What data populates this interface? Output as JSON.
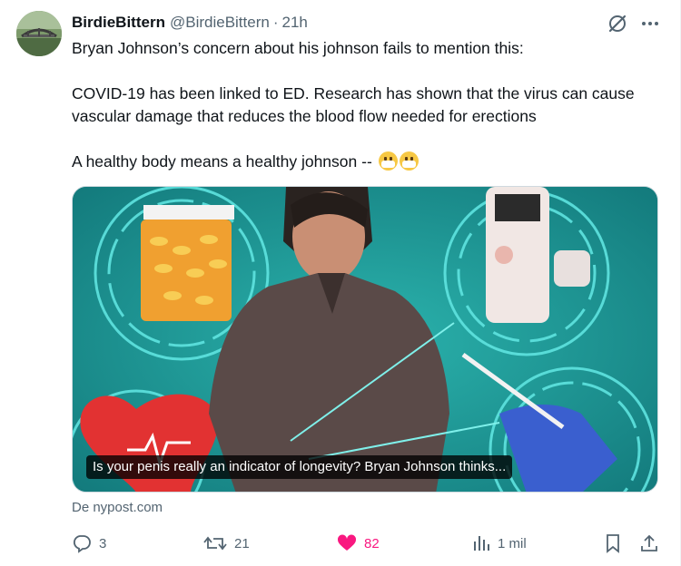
{
  "post": {
    "display_name": "BirdieBittern",
    "handle": "@BirdieBittern",
    "separator": "·",
    "time": "21h",
    "text_lines": [
      "Bryan Johnson’s concern about his johnson fails to mention this:",
      "COVID-19 has been linked to ED. Research has shown that the virus can cause",
      "vascular damage that reduces the blood flow needed for erections",
      "A healthy body means a healthy johnson --"
    ]
  },
  "card": {
    "caption": "Is your penis really an indicator of longevity? Bryan Johnson thinks...",
    "source": "De nypost.com"
  },
  "actions": {
    "replies": "3",
    "reposts": "21",
    "likes": "82",
    "views": "1 mil"
  },
  "icons": {
    "grok": "grok-icon",
    "more": "more-icon",
    "reply": "reply-icon",
    "repost": "repost-icon",
    "like": "heart-icon",
    "views": "views-icon",
    "bookmark": "bookmark-icon",
    "share": "share-icon"
  },
  "colors": {
    "like": "#f91880",
    "muted": "#536471",
    "text": "#0f1419",
    "card_teal": "#1b8f8f"
  }
}
